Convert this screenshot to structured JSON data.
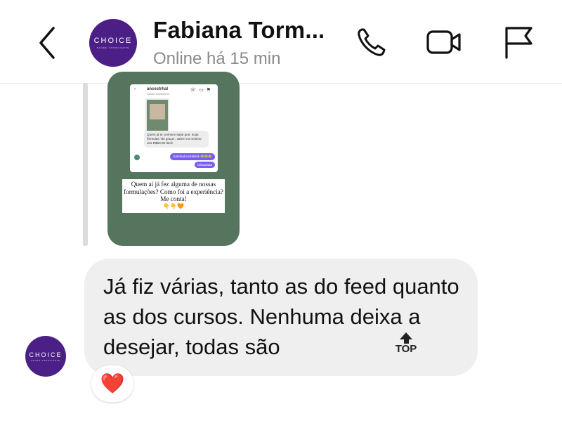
{
  "header": {
    "avatar_text": "CHOICE",
    "avatar_subtext": "SAÚDE CONSCIENTE",
    "contact_name": "Fabiana Torm...",
    "status": "Online há 15 min"
  },
  "icons": {
    "back": "chevron-left-icon",
    "call": "phone-icon",
    "video": "video-camera-icon",
    "report": "flag-icon"
  },
  "story_reply": {
    "mini_name": "ancestrhal",
    "mini_subtitle": "Saúde consciente",
    "mini_message": "Quem já te conhece sabe que, suas fórmulas \"de graça\", valem no mínimo uns R$60,00 tácil!",
    "mini_sent_1": "Hahahaha kkkkkkk 😂😂😂",
    "mini_sent_2": "Obaaaaaa",
    "caption": "Quem aí já fez alguma de nossas formulações? Como foi a experiência? Me conta!",
    "caption_emoji": "👇👇🧡"
  },
  "message": {
    "avatar_text": "CHOICE",
    "avatar_subtext": "SAÚDE CONSCIENTE",
    "text": "Já fiz várias, tanto as do feed quanto as dos cursos. Nenhuma deixa a desejar, todas são",
    "top_badge": "TOP",
    "reaction": "❤️"
  },
  "colors": {
    "brand_purple": "#4b1f86",
    "story_green": "#55755f",
    "bubble_gray": "#efefef",
    "status_gray": "#8a8a8a"
  }
}
